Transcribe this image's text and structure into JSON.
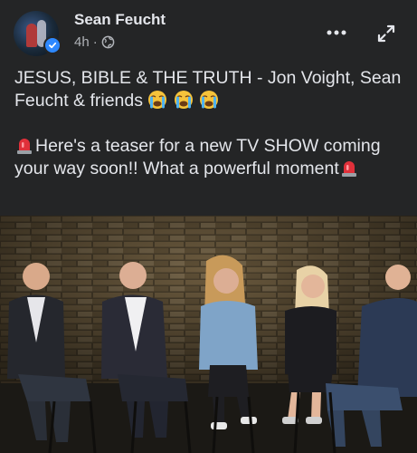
{
  "post": {
    "author": "Sean Feucht",
    "time": "4h",
    "separator": "·",
    "audience_icon": "globe-icon",
    "line1": "JESUS, BIBLE & THE TRUTH - Jon Voight, Sean Feucht & friends",
    "line2_a": "Here's a teaser for a new TV SHOW coming your way soon!! What a powerful moment",
    "emoji_crying": "crying-face-emoji",
    "emoji_siren": "police-light-emoji"
  },
  "colors": {
    "background": "#242526",
    "text": "#e4e6eb",
    "secondary_text": "#b0b3b8",
    "verified": "#2d88ff"
  },
  "media": {
    "type": "video",
    "description_icon": "video-frame"
  }
}
